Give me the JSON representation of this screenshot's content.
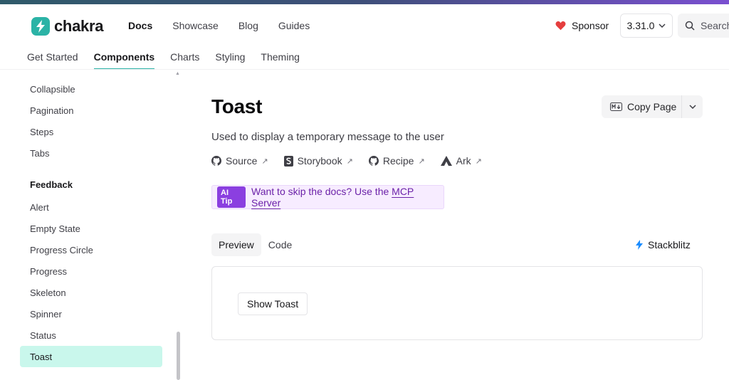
{
  "brand": {
    "name": "chakra",
    "color": "#2bb3a6"
  },
  "primary_nav": [
    {
      "label": "Docs",
      "active": true
    },
    {
      "label": "Showcase"
    },
    {
      "label": "Blog"
    },
    {
      "label": "Guides"
    }
  ],
  "header": {
    "sponsor_label": "Sponsor",
    "version": "3.31.0",
    "search_placeholder": "Search"
  },
  "subnav": [
    {
      "label": "Get Started"
    },
    {
      "label": "Components",
      "active": true
    },
    {
      "label": "Charts"
    },
    {
      "label": "Styling"
    },
    {
      "label": "Theming"
    }
  ],
  "sidebar": {
    "items_top": [
      "Collapsible",
      "Pagination",
      "Steps",
      "Tabs"
    ],
    "group_title": "Feedback",
    "items": [
      "Alert",
      "Empty State",
      "Progress Circle",
      "Progress",
      "Skeleton",
      "Spinner",
      "Status",
      "Toast"
    ],
    "active_item": "Toast"
  },
  "page": {
    "title": "Toast",
    "copy_page_label": "Copy Page",
    "description": "Used to display a temporary message to the user",
    "links": [
      "Source",
      "Storybook",
      "Recipe",
      "Ark"
    ],
    "ai_tip": {
      "badge": "AI Tip",
      "text": "Want to skip the docs? Use the ",
      "link": "MCP Server"
    },
    "tabs": [
      "Preview",
      "Code"
    ],
    "active_tab": "Preview",
    "stackblitz_label": "Stackblitz",
    "demo_button_label": "Show Toast"
  }
}
